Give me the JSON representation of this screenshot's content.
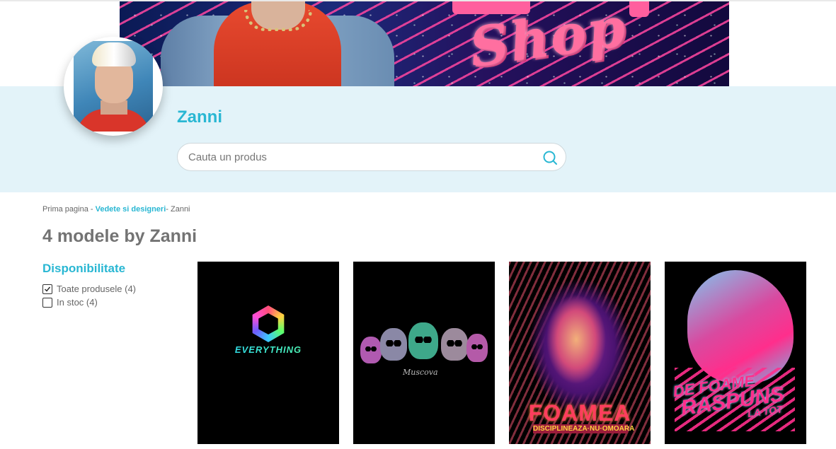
{
  "banner": {
    "shop_text": "Shop"
  },
  "profile": {
    "name": "Zanni"
  },
  "search": {
    "placeholder": "Cauta un produs"
  },
  "breadcrumb": {
    "home": "Prima pagina -",
    "section": "Vedete si designeri",
    "current": "- Zanni"
  },
  "page_title": "4 modele by Zanni",
  "filters": {
    "title": "Disponibilitate",
    "options": [
      {
        "label": "Toate produsele (4)",
        "checked": true
      },
      {
        "label": "In stoc (4)",
        "checked": false
      }
    ]
  },
  "products": [
    {
      "art_text": "EVERYTHING"
    },
    {
      "art_text": "Muscova"
    },
    {
      "art_text": "FOAMEA",
      "art_subtext": "DISCIPLINEAZA·NU·OMOARA"
    },
    {
      "art_text_1": "DE FOAME",
      "art_text_2": "RASPUNS",
      "art_text_3": "LA TOT"
    }
  ],
  "colors": {
    "accent": "#29b7d3",
    "hero_bg": "#e3f3f9",
    "title": "#737373"
  },
  "icons": {
    "search": "search-icon",
    "checkbox": "check-icon"
  }
}
